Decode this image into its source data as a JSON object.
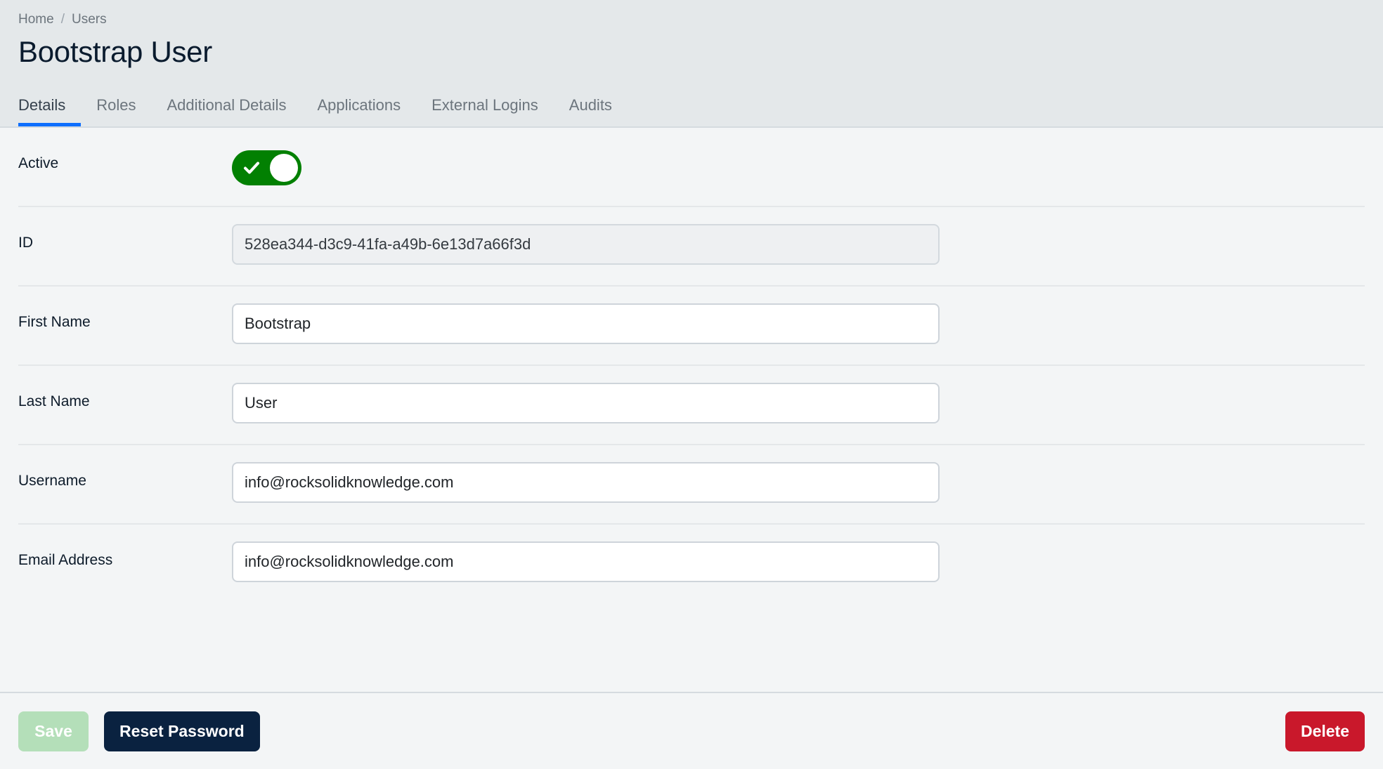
{
  "breadcrumb": {
    "items": [
      {
        "label": "Home"
      },
      {
        "label": "Users"
      }
    ],
    "separator": "/"
  },
  "header": {
    "title": "Bootstrap User"
  },
  "tabs": [
    {
      "label": "Details",
      "active": true
    },
    {
      "label": "Roles",
      "active": false
    },
    {
      "label": "Additional Details",
      "active": false
    },
    {
      "label": "Applications",
      "active": false
    },
    {
      "label": "External Logins",
      "active": false
    },
    {
      "label": "Audits",
      "active": false
    }
  ],
  "form": {
    "active": {
      "label": "Active",
      "value": "on",
      "icon": "check-icon"
    },
    "id": {
      "label": "ID",
      "value": "528ea344-d3c9-41fa-a49b-6e13d7a66f3d",
      "placeholder": "",
      "readonly": true
    },
    "first_name": {
      "label": "First Name",
      "value": "Bootstrap",
      "placeholder": ""
    },
    "last_name": {
      "label": "Last Name",
      "value": "User",
      "placeholder": ""
    },
    "username": {
      "label": "Username",
      "value": "info@rocksolidknowledge.com",
      "placeholder": ""
    },
    "email": {
      "label": "Email Address",
      "value": "info@rocksolidknowledge.com",
      "placeholder": ""
    }
  },
  "footer": {
    "save_label": "Save",
    "reset_password_label": "Reset Password",
    "delete_label": "Delete"
  },
  "colors": {
    "accent": "#0d6efd",
    "toggle_on": "#028002",
    "danger": "#c9182b",
    "primary_dark": "#0a2240",
    "save_disabled": "#b4dfb9",
    "header_bg": "#e4e8ea",
    "body_bg": "#f3f5f6"
  }
}
